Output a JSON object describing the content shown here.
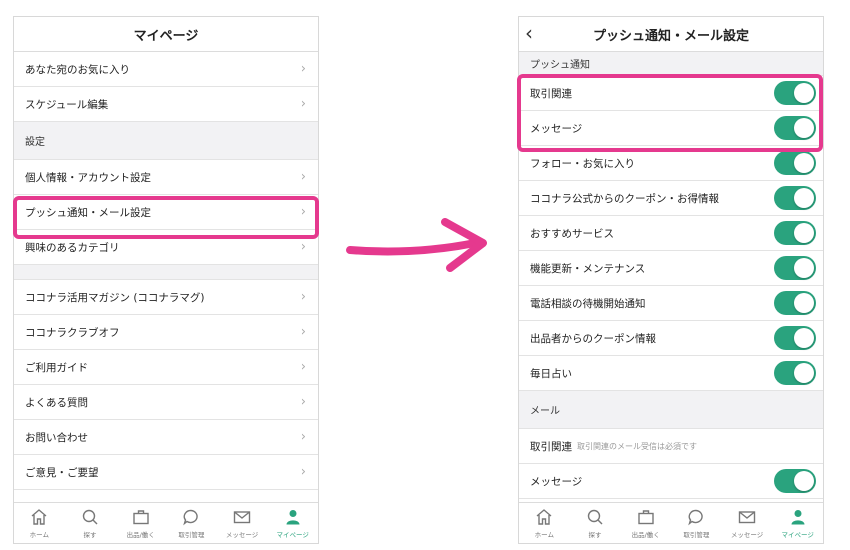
{
  "left": {
    "title": "マイページ",
    "group1": [
      "あなた宛のお気に入り",
      "スケジュール編集"
    ],
    "section_settings": "設定",
    "group2": [
      "個人情報・アカウント設定",
      "プッシュ通知・メール設定",
      "興味のあるカテゴリ"
    ],
    "group3": [
      "ココナラ活用マガジン (ココナラマグ)",
      "ココナラクラブオフ",
      "ご利用ガイド",
      "よくある質問",
      "お問い合わせ",
      "ご意見・ご要望"
    ]
  },
  "right": {
    "title": "プッシュ通知・メール設定",
    "section_push": "プッシュ通知",
    "push_items": [
      "取引関連",
      "メッセージ",
      "フォロー・お気に入り",
      "ココナラ公式からのクーポン・お得情報",
      "おすすめサービス",
      "機能更新・メンテナンス",
      "電話相談の待機開始通知",
      "出品者からのクーポン情報",
      "毎日占い"
    ],
    "section_mail": "メール",
    "mail_items": [
      {
        "label": "取引関連",
        "note": "取引関連のメール受信は必須です"
      },
      {
        "label": "メッセージ",
        "note": ""
      }
    ]
  },
  "tabs": [
    {
      "label": "ホーム",
      "icon": "home-icon"
    },
    {
      "label": "探す",
      "icon": "search-icon"
    },
    {
      "label": "出品/働く",
      "icon": "briefcase-icon"
    },
    {
      "label": "取引管理",
      "icon": "chat-icon"
    },
    {
      "label": "メッセージ",
      "icon": "mail-icon"
    },
    {
      "label": "マイページ",
      "icon": "person-icon"
    }
  ],
  "colors": {
    "accent": "#2aa37e",
    "highlight": "#e5398e"
  }
}
